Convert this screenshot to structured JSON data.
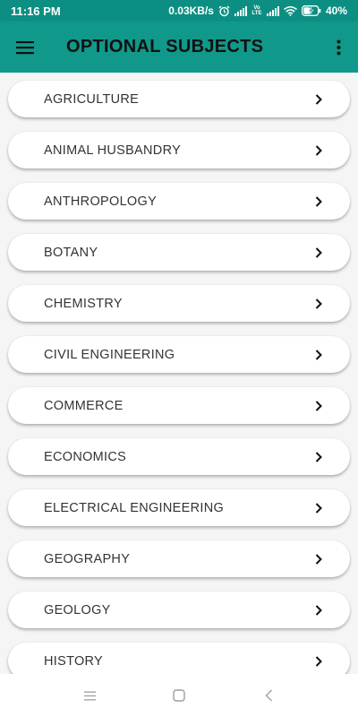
{
  "status_bar": {
    "time": "11:16 PM",
    "network_speed": "0.03KB/s",
    "battery": "40%",
    "volte": "Vo LTE",
    "icons": [
      "alarm-icon",
      "signal-icon",
      "volte-icon",
      "signal-icon",
      "wifi-icon",
      "battery-charging-icon"
    ]
  },
  "app_bar": {
    "title": "OPTIONAL SUBJECTS",
    "menu_icon": "hamburger-menu-icon",
    "overflow_icon": "more-vertical-icon"
  },
  "subjects": [
    {
      "label": "AGRICULTURE"
    },
    {
      "label": "ANIMAL HUSBANDRY"
    },
    {
      "label": "ANTHROPOLOGY"
    },
    {
      "label": "BOTANY"
    },
    {
      "label": "CHEMISTRY"
    },
    {
      "label": "CIVIL ENGINEERING"
    },
    {
      "label": "COMMERCE"
    },
    {
      "label": "ECONOMICS"
    },
    {
      "label": "ELECTRICAL ENGINEERING"
    },
    {
      "label": "GEOGRAPHY"
    },
    {
      "label": "GEOLOGY"
    },
    {
      "label": "HISTORY"
    }
  ],
  "nav_bar": {
    "icons": [
      "recents-icon",
      "home-icon",
      "back-icon"
    ]
  },
  "colors": {
    "status_bar": "#0c8f82",
    "app_bar": "#10988a",
    "background": "#f5f5f5",
    "card": "#ffffff"
  }
}
